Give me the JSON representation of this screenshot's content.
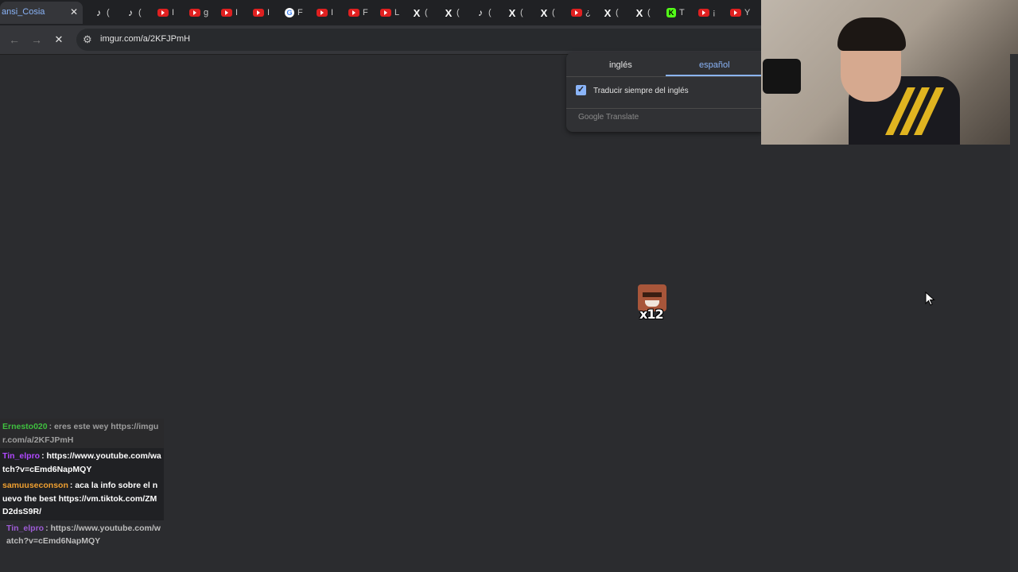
{
  "browser": {
    "active_tab_title": "ansi_Cosia",
    "tabs": [
      {
        "icon": "tiktok-icon",
        "label": "("
      },
      {
        "icon": "tiktok-icon",
        "label": "("
      },
      {
        "icon": "youtube-icon",
        "label": "I"
      },
      {
        "icon": "youtube-icon",
        "label": "g"
      },
      {
        "icon": "youtube-icon",
        "label": "I"
      },
      {
        "icon": "youtube-icon",
        "label": "I"
      },
      {
        "icon": "google-icon",
        "label": "F"
      },
      {
        "icon": "youtube-icon",
        "label": "I"
      },
      {
        "icon": "youtube-icon",
        "label": "F"
      },
      {
        "icon": "youtube-icon",
        "label": "L"
      },
      {
        "icon": "x-icon",
        "label": "("
      },
      {
        "icon": "x-icon",
        "label": "("
      },
      {
        "icon": "tiktok-icon",
        "label": "("
      },
      {
        "icon": "x-icon",
        "label": "("
      },
      {
        "icon": "x-icon",
        "label": "("
      },
      {
        "icon": "youtube-icon",
        "label": "¿"
      },
      {
        "icon": "x-icon",
        "label": "("
      },
      {
        "icon": "x-icon",
        "label": "("
      },
      {
        "icon": "kick-icon",
        "label": "T"
      },
      {
        "icon": "youtube-icon",
        "label": "¡"
      },
      {
        "icon": "youtube-icon",
        "label": "Y"
      }
    ],
    "url": "imgur.com/a/2KFJPmH"
  },
  "translate_popup": {
    "source_lang": "inglés",
    "target_lang": "español",
    "always_translate_label": "Traducir siempre del inglés",
    "always_translate_checked": true,
    "brand": "Google Translate"
  },
  "emote": {
    "count_label": "x12"
  },
  "chat": {
    "messages": [
      {
        "user": "Ernesto020",
        "user_color": "#3fbf3f",
        "text": ": eres este wey https://imgur.com/a/2KFJPmH",
        "style": "faint"
      },
      {
        "user": "Tin_elpro",
        "user_color": "#b048ff",
        "text": ": https://www.youtube.com/watch?v=cEmd6NapMQY",
        "style": "normal"
      },
      {
        "user": "samuuseconson",
        "user_color": "#f0a030",
        "text": ": aca la info sobre el nuevo the best https://vm.tiktok.com/ZMD2dsS9R/",
        "style": "normal"
      },
      {
        "user": "Tin_elpro",
        "user_color": "#9e5cd6",
        "text": ": https://www.youtube.com/watch?v=cEmd6NapMQY",
        "style": "dim"
      }
    ]
  },
  "colors": {
    "page_bg": "#2b2c2f",
    "accent": "#8ab4f8"
  }
}
